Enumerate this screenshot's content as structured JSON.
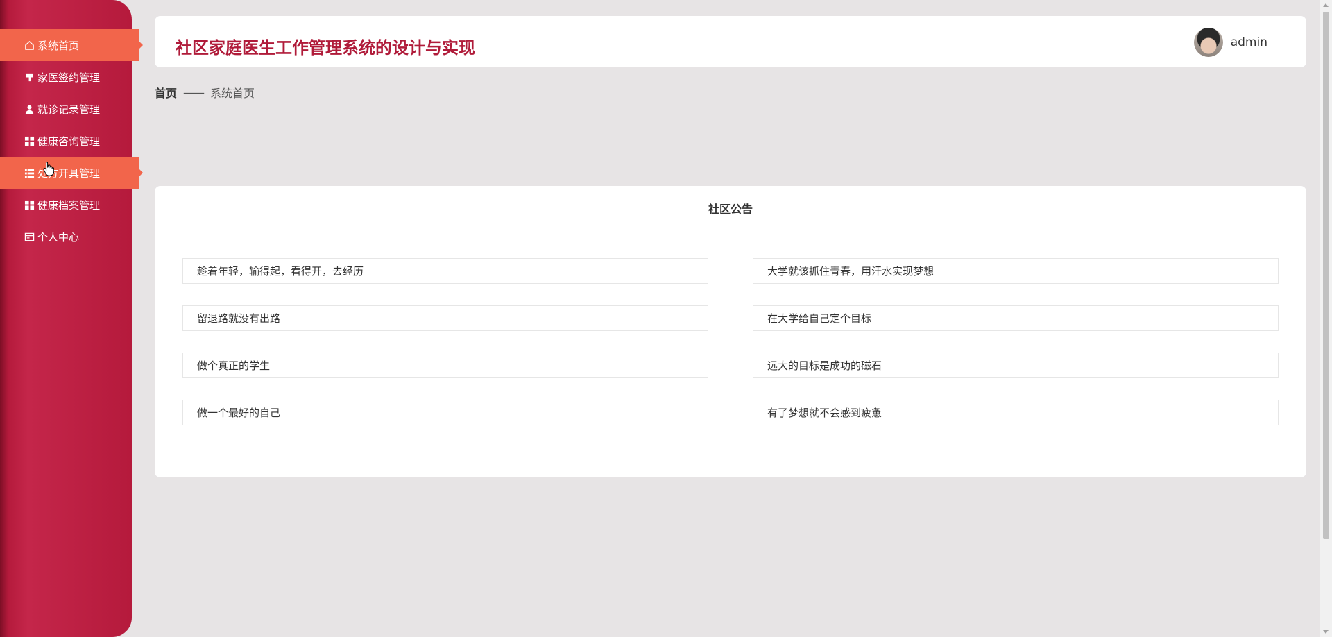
{
  "app": {
    "title": "社区家庭医生工作管理系统的设计与实现",
    "user": "admin"
  },
  "sidebar": {
    "items": [
      {
        "label": "系统首页",
        "icon": "home-icon",
        "active": true
      },
      {
        "label": "家医签约管理",
        "icon": "stamp-icon",
        "active": false
      },
      {
        "label": "就诊记录管理",
        "icon": "user-icon",
        "active": false
      },
      {
        "label": "健康咨询管理",
        "icon": "grid-icon",
        "active": false
      },
      {
        "label": "处方开具管理",
        "icon": "list-icon",
        "active": true
      },
      {
        "label": "健康档案管理",
        "icon": "grid-icon",
        "active": false
      },
      {
        "label": "个人中心",
        "icon": "card-icon",
        "active": false
      }
    ]
  },
  "breadcrumb": {
    "home": "首页",
    "separator": "——",
    "current": "系统首页"
  },
  "notice": {
    "title": "社区公告",
    "items": [
      "趁着年轻，输得起，看得开，去经历",
      "大学就该抓住青春，用汗水实现梦想",
      "留退路就没有出路",
      "在大学给自己定个目标",
      "做个真正的学生",
      "远大的目标是成功的磁石",
      "做一个最好的自己",
      "有了梦想就不会感到疲惫"
    ]
  },
  "colors": {
    "sidebar": "#b51a3c",
    "active": "#f2654b",
    "title": "#b01b3a",
    "background": "#e7e4e5"
  }
}
